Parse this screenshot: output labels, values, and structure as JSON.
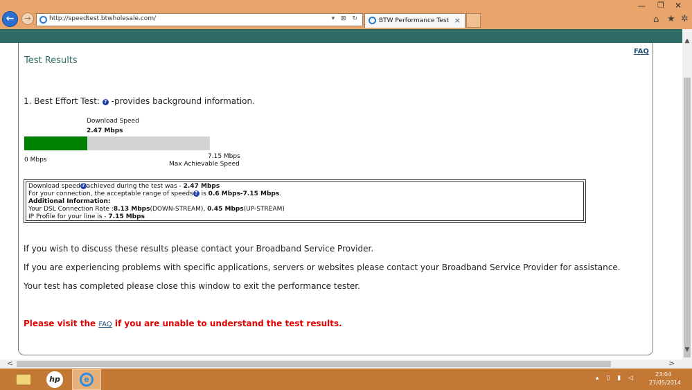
{
  "browser": {
    "url": "http://speedtest.btwholesale.com/",
    "url_tools": "▾ ⊠ ↻",
    "tab_title": "BTW Performance Test",
    "tab_close": "×",
    "back_glyph": "←",
    "forward_glyph": "→",
    "home_glyph": "⌂",
    "star_glyph": "★",
    "gear_glyph": "✲",
    "min_glyph": "—",
    "max_glyph": "❐",
    "close_glyph": "✕"
  },
  "page": {
    "title": "Test Results",
    "faq_link": "FAQ"
  },
  "best_effort": {
    "heading": "1. Best Effort Test:",
    "info_glyph": "?",
    "description": "-provides background information."
  },
  "speed_bar": {
    "label": "Download  Speed",
    "value": "2.47 Mbps",
    "min_label": "0 Mbps",
    "max_value": "7.15 Mbps",
    "max_label": "Max Achievable Speed",
    "fill_ratio": 0.34,
    "fill_color": "#008000",
    "track_color": "#d4d4d4"
  },
  "info_box": {
    "line1_prefix": "Download speed",
    "line1_middle": "achieved during the test was - ",
    "line1_value": "2.47 Mbps",
    "line2_prefix": "For your connection, the acceptable range of speeds",
    "line2_middle": " is ",
    "line2_value": "0.6 Mbps-7.15 Mbps",
    "line2_suffix": ".",
    "additional_heading": "Additional Information:",
    "dsl_prefix": "Your DSL Connection Rate :",
    "dsl_down": "8.13 Mbps",
    "dsl_down_suffix": "(DOWN-STREAM), ",
    "dsl_up": "0.45 Mbps",
    "dsl_up_suffix": "(UP-STREAM)",
    "ip_prefix": "IP Profile for your line is - ",
    "ip_value": "7.15 Mbps"
  },
  "messages": {
    "line1": "If you wish to discuss these results please contact your Broadband Service Provider.",
    "line2": "If you are experiencing problems with specific applications, servers or websites please contact your Broadband Service Provider for assistance.",
    "line3": "Your test has completed please close this window to exit the performance tester."
  },
  "visit_faq": {
    "prefix": "Please visit the ",
    "link": "FAQ",
    "suffix": " if you are unable to understand the test results."
  },
  "taskbar": {
    "hp_label": "hp",
    "ie_glyph": "e",
    "tray": "▴ ▯ ▮ ◁",
    "time": "23:04",
    "date": "27/05/2014"
  },
  "scrollbars": {
    "up": "▲",
    "down": "▼",
    "left": "<",
    "right": ">"
  }
}
